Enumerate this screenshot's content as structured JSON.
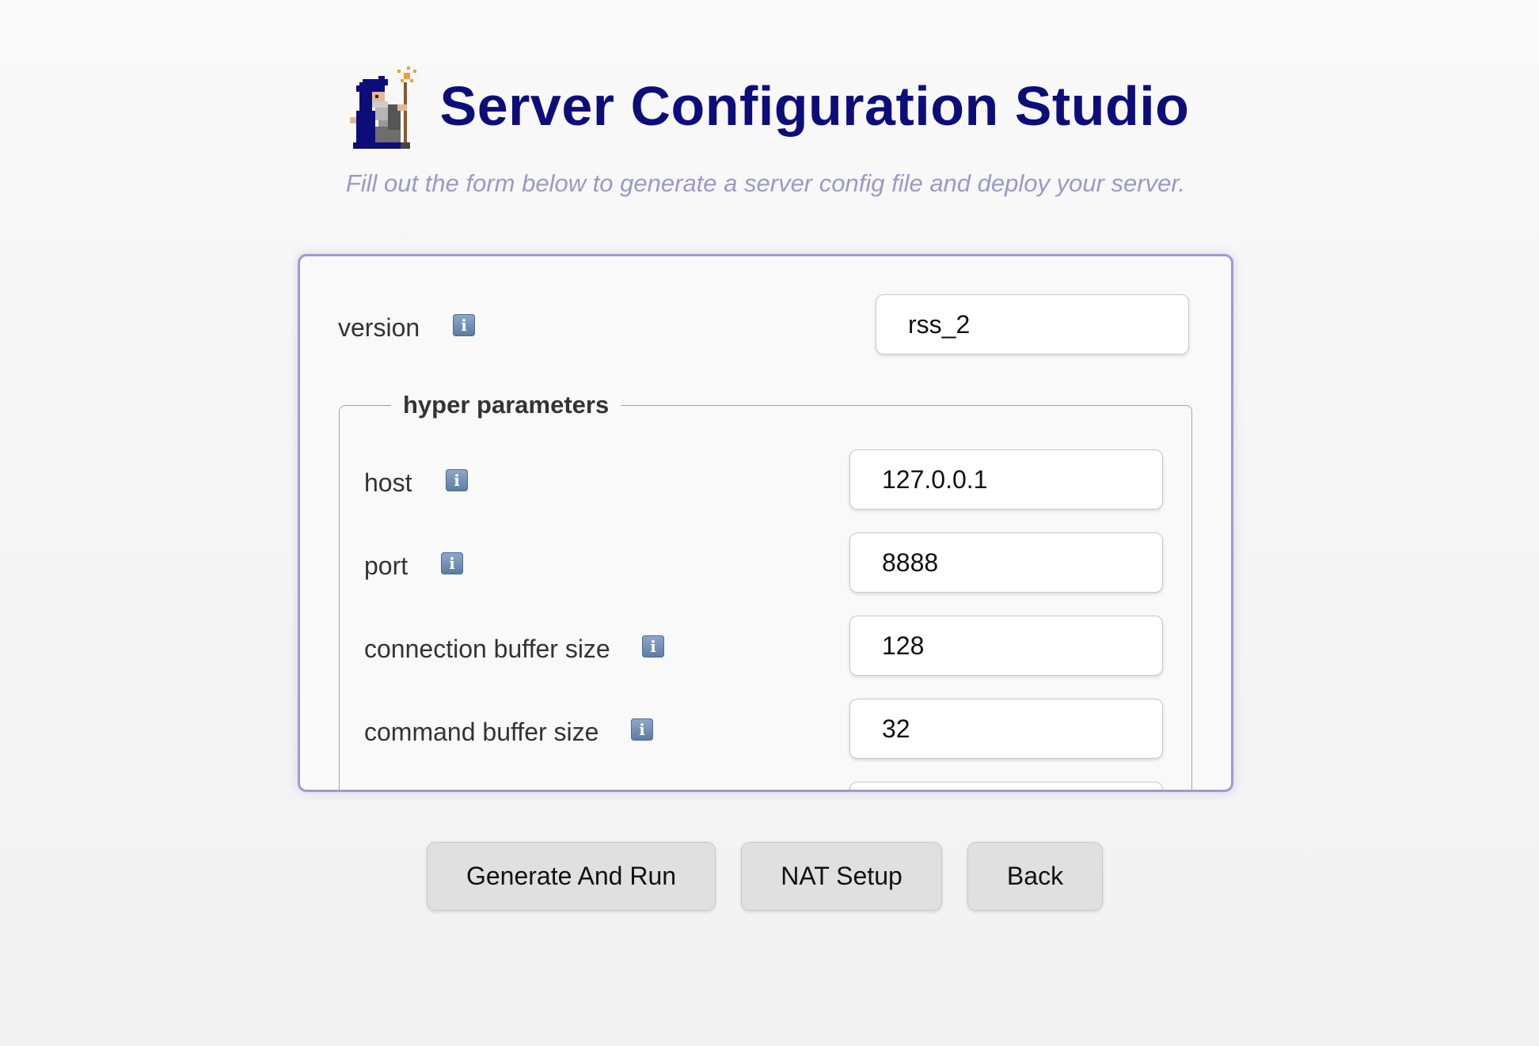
{
  "header": {
    "title": "Server Configuration Studio",
    "subtitle": "Fill out the form below to generate a server config file and deploy your server.",
    "title_color": "#0d0d7a",
    "subtitle_color": "#9a9ac8",
    "logo_icon": "wizard-icon"
  },
  "form": {
    "info_icon_glyph": "i",
    "version": {
      "label": "version",
      "value": "rss_2"
    },
    "hyper_parameters": {
      "legend": "hyper parameters",
      "fields": {
        "host": {
          "label": "host",
          "value": "127.0.0.1"
        },
        "port": {
          "label": "port",
          "value": "8888"
        },
        "connection_buffer_size": {
          "label": "connection buffer size",
          "value": "128"
        },
        "command_buffer_size": {
          "label": "command buffer size",
          "value": "32"
        }
      }
    }
  },
  "actions": {
    "generate_and_run": "Generate And Run",
    "nat_setup": "NAT Setup",
    "back": "Back"
  },
  "colors": {
    "panel_border": "#9c9cd0",
    "info_icon": "#6b89b0",
    "button_bg": "#e0e0e0"
  }
}
